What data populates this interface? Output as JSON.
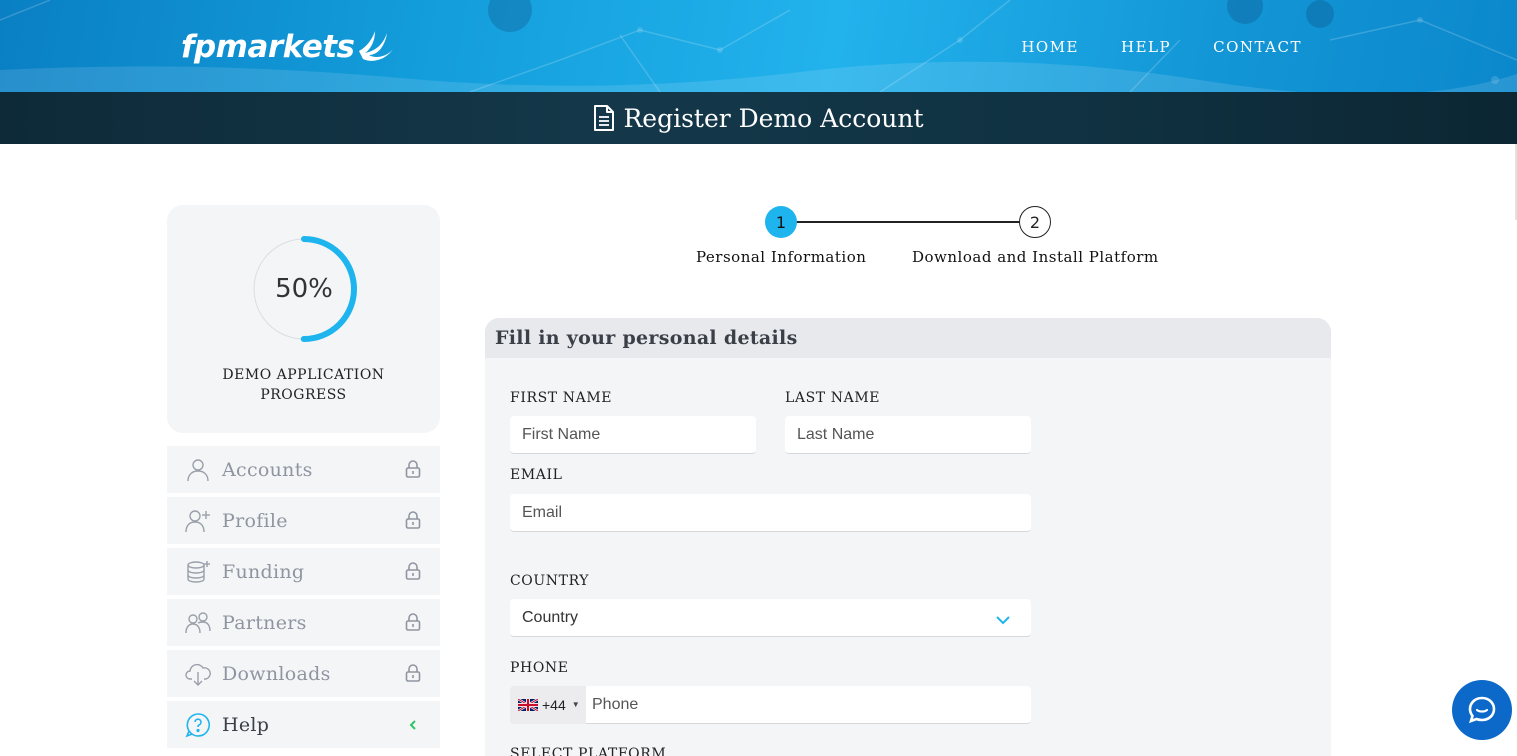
{
  "brand": {
    "logo_text": "fpmarkets",
    "accent": "#1eb4ee",
    "dark": "#0e2a38"
  },
  "nav": {
    "items": [
      "HOME",
      "HELP",
      "CONTACT"
    ]
  },
  "page": {
    "title": "Register Demo Account"
  },
  "progress": {
    "percent_label": "50%",
    "value": 0.5,
    "label": "DEMO APPLICATION PROGRESS"
  },
  "sidebar": {
    "items": [
      {
        "label": "Accounts",
        "icon": "user-icon",
        "locked": true
      },
      {
        "label": "Profile",
        "icon": "user-add-icon",
        "locked": true
      },
      {
        "label": "Funding",
        "icon": "coins-icon",
        "locked": true
      },
      {
        "label": "Partners",
        "icon": "users-icon",
        "locked": true
      },
      {
        "label": "Downloads",
        "icon": "cloud-download-icon",
        "locked": true
      },
      {
        "label": "Help",
        "icon": "help-icon",
        "locked": false
      }
    ]
  },
  "stepper": {
    "steps": [
      {
        "number": "1",
        "label": "Personal Information",
        "active": true
      },
      {
        "number": "2",
        "label": "Download and Install Platform",
        "active": false
      }
    ]
  },
  "form": {
    "heading": "Fill in your personal details",
    "first_name": {
      "label": "FIRST NAME",
      "placeholder": "First Name"
    },
    "last_name": {
      "label": "LAST NAME",
      "placeholder": "Last Name"
    },
    "email": {
      "label": "EMAIL",
      "placeholder": "Email"
    },
    "country": {
      "label": "COUNTRY",
      "value": "Country"
    },
    "phone": {
      "label": "PHONE",
      "dial_code": "+44",
      "placeholder": "Phone"
    },
    "platform": {
      "label": "SELECT PLATFORM"
    }
  }
}
